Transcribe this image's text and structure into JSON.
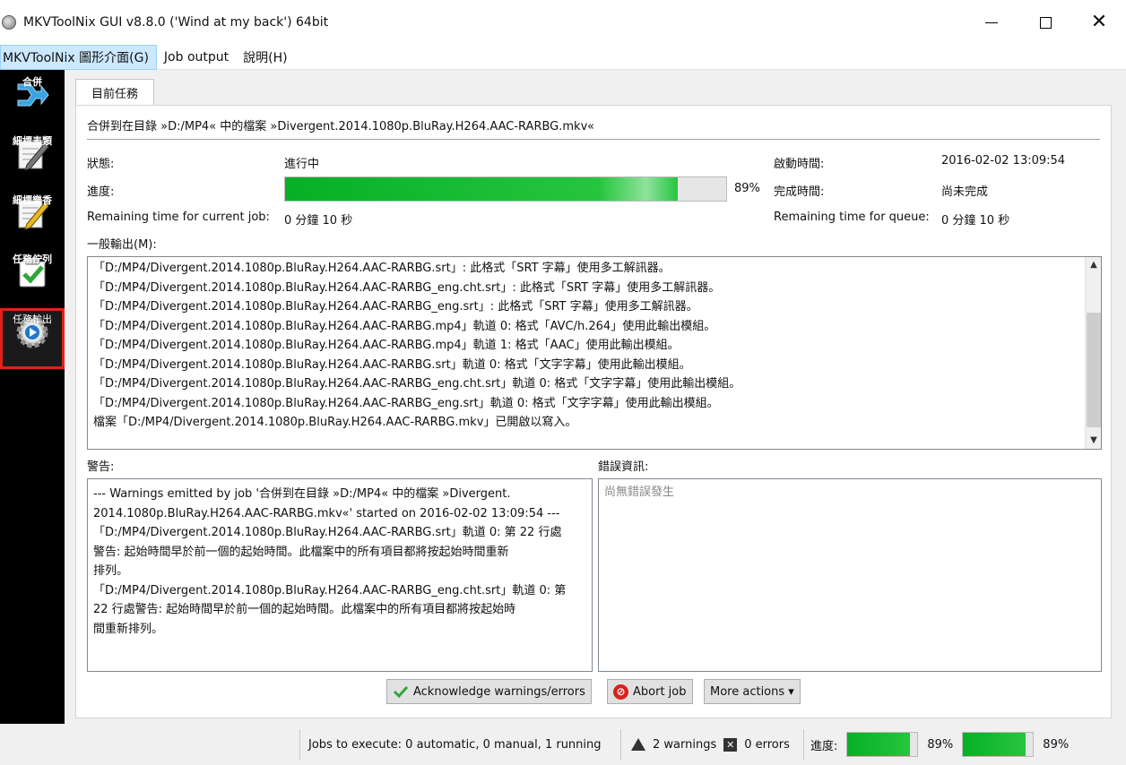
{
  "window": {
    "title": "MKVToolNix GUI v8.8.0 ('Wind at my back') 64bit",
    "minimize": "—",
    "maximize": "☐",
    "close": "✕"
  },
  "menu": {
    "items": [
      "MKVToolNix 圖形介面(G)",
      "Job output",
      "說明(H)"
    ]
  },
  "sidebar": {
    "items": [
      {
        "label": "合併",
        "icon": "merge-arrow-icon"
      },
      {
        "label": "細標表類",
        "icon": "pencil-edit-icon"
      },
      {
        "label": "細標樂香",
        "icon": "pencil-yellow-icon"
      },
      {
        "label": "任務佇列",
        "icon": "checklist-icon"
      },
      {
        "label": "任務輸出",
        "icon": "gear-play-icon"
      }
    ]
  },
  "tab": {
    "label": "目前任務"
  },
  "job": {
    "title": "合併到在目錄 »D:/MP4« 中的檔案 »Divergent.2014.1080p.BluRay.H264.AAC-RARBG.mkv«",
    "status_label": "狀態:",
    "status_value": "進行中",
    "progress_label": "進度:",
    "progress_fraction": 0.89,
    "progress_text": "89%",
    "start_label": "啟動時間:",
    "start_value": "2016-02-02 13:09:54",
    "finish_label": "完成時間:",
    "finish_value": "尚未完成",
    "remaining_job_label": "Remaining time for current job:",
    "remaining_job_value": "0 分鐘 10 秒",
    "remaining_queue_label": "Remaining time for queue:",
    "remaining_queue_value": "0 分鐘 10 秒",
    "output_label": "一般輸出(M):"
  },
  "output_log": [
    "「D:/MP4/Divergent.2014.1080p.BluRay.H264.AAC-RARBG.srt」: 此格式「SRT 字幕」使用多工解訊器。",
    "「D:/MP4/Divergent.2014.1080p.BluRay.H264.AAC-RARBG_eng.cht.srt」: 此格式「SRT 字幕」使用多工解訊器。",
    "「D:/MP4/Divergent.2014.1080p.BluRay.H264.AAC-RARBG_eng.srt」: 此格式「SRT 字幕」使用多工解訊器。",
    "「D:/MP4/Divergent.2014.1080p.BluRay.H264.AAC-RARBG.mp4」軌道 0: 格式「AVC/h.264」使用此輸出模組。",
    "「D:/MP4/Divergent.2014.1080p.BluRay.H264.AAC-RARBG.mp4」軌道 1: 格式「AAC」使用此輸出模組。",
    "「D:/MP4/Divergent.2014.1080p.BluRay.H264.AAC-RARBG.srt」軌道 0: 格式「文字字幕」使用此輸出模組。",
    "「D:/MP4/Divergent.2014.1080p.BluRay.H264.AAC-RARBG_eng.cht.srt」軌道 0: 格式「文字字幕」使用此輸出模組。",
    "「D:/MP4/Divergent.2014.1080p.BluRay.H264.AAC-RARBG_eng.srt」軌道 0: 格式「文字字幕」使用此輸出模組。",
    "檔案「D:/MP4/Divergent.2014.1080p.BluRay.H264.AAC-RARBG.mkv」已開啟以寫入。"
  ],
  "warnings": {
    "label": "警告:",
    "lines": [
      "--- Warnings emitted by job '合併到在目錄 »D:/MP4« 中的檔案 »Divergent.",
      "2014.1080p.BluRay.H264.AAC-RARBG.mkv«' started on 2016-02-02 13:09:54 ---",
      "「D:/MP4/Divergent.2014.1080p.BluRay.H264.AAC-RARBG.srt」軌道 0: 第 22 行處",
      "警告: 起始時間早於前一個的起始時間。此檔案中的所有項目都將按起始時間重新",
      "排列。",
      "「D:/MP4/Divergent.2014.1080p.BluRay.H264.AAC-RARBG_eng.cht.srt」軌道 0: 第",
      "22 行處警告: 起始時間早於前一個的起始時間。此檔案中的所有項目都將按起始時",
      "間重新排列。"
    ]
  },
  "errors": {
    "label": "錯誤資訊:",
    "text": "尚無錯誤發生"
  },
  "buttons": {
    "acknowledge": "Acknowledge warnings/errors",
    "abort": "Abort job",
    "more": "More actions ▾"
  },
  "statusbar": {
    "jobs": "Jobs to execute:  0 automatic, 0 manual, 1 running",
    "warnings": "2 warnings",
    "errors": "0 errors",
    "progress_label": "進度:",
    "progress_job_fraction": 0.89,
    "progress_job_text": "89%",
    "progress_total_fraction": 0.89,
    "progress_total_text": "89%"
  },
  "colors": {
    "progress": "#06b025",
    "highlight": "#e0221b",
    "sidebar_bg": "#000000"
  }
}
